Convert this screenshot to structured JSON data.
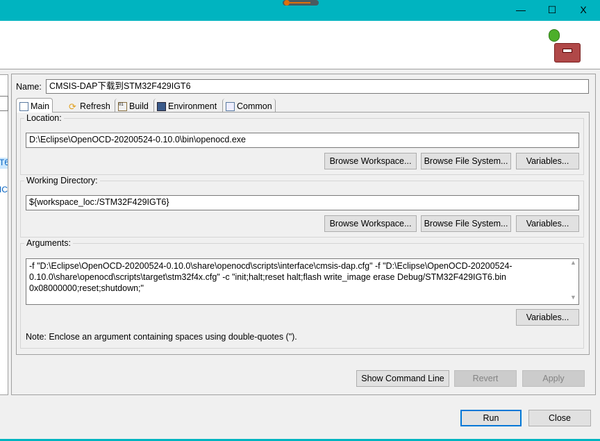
{
  "window": {
    "controls": {
      "minimize": "—",
      "maximize": "☐",
      "close": "X"
    }
  },
  "left_panel": {
    "items": [
      "T6",
      "IC"
    ]
  },
  "name": {
    "label": "Name:",
    "value": "CMSIS-DAP下载到STM32F429IGT6"
  },
  "tabs": [
    {
      "label": "Main",
      "icon": "main-tab-icon"
    },
    {
      "label": "Refresh",
      "icon": "refresh-icon"
    },
    {
      "label": "Build",
      "icon": "build-icon"
    },
    {
      "label": "Environment",
      "icon": "environment-icon"
    },
    {
      "label": "Common",
      "icon": "common-icon"
    }
  ],
  "location": {
    "label": "Location:",
    "value": "D:\\Eclipse\\OpenOCD-20200524-0.10.0\\bin\\openocd.exe",
    "browse_workspace": "Browse Workspace...",
    "browse_fs": "Browse File System...",
    "variables": "Variables..."
  },
  "working_dir": {
    "label": "Working Directory:",
    "value": "${workspace_loc:/STM32F429IGT6}",
    "browse_workspace": "Browse Workspace...",
    "browse_fs": "Browse File System...",
    "variables": "Variables..."
  },
  "arguments": {
    "label": "Arguments:",
    "value": "-f \"D:\\Eclipse\\OpenOCD-20200524-0.10.0\\share\\openocd\\scripts\\interface\\cmsis-dap.cfg\" -f \"D:\\Eclipse\\OpenOCD-20200524-0.10.0\\share\\openocd\\scripts\\target\\stm32f4x.cfg\" -c \"init;halt;reset halt;flash write_image erase Debug/STM32F429IGT6.bin 0x08000000;reset;shutdown;\"",
    "variables": "Variables...",
    "note": "Note: Enclose an argument containing spaces using double-quotes (\")."
  },
  "actions": {
    "show_command_line": "Show Command Line",
    "revert": "Revert",
    "apply": "Apply",
    "run": "Run",
    "close": "Close"
  },
  "colors": {
    "titlebar": "#00b4c0",
    "default_button_border": "#0078d7"
  }
}
